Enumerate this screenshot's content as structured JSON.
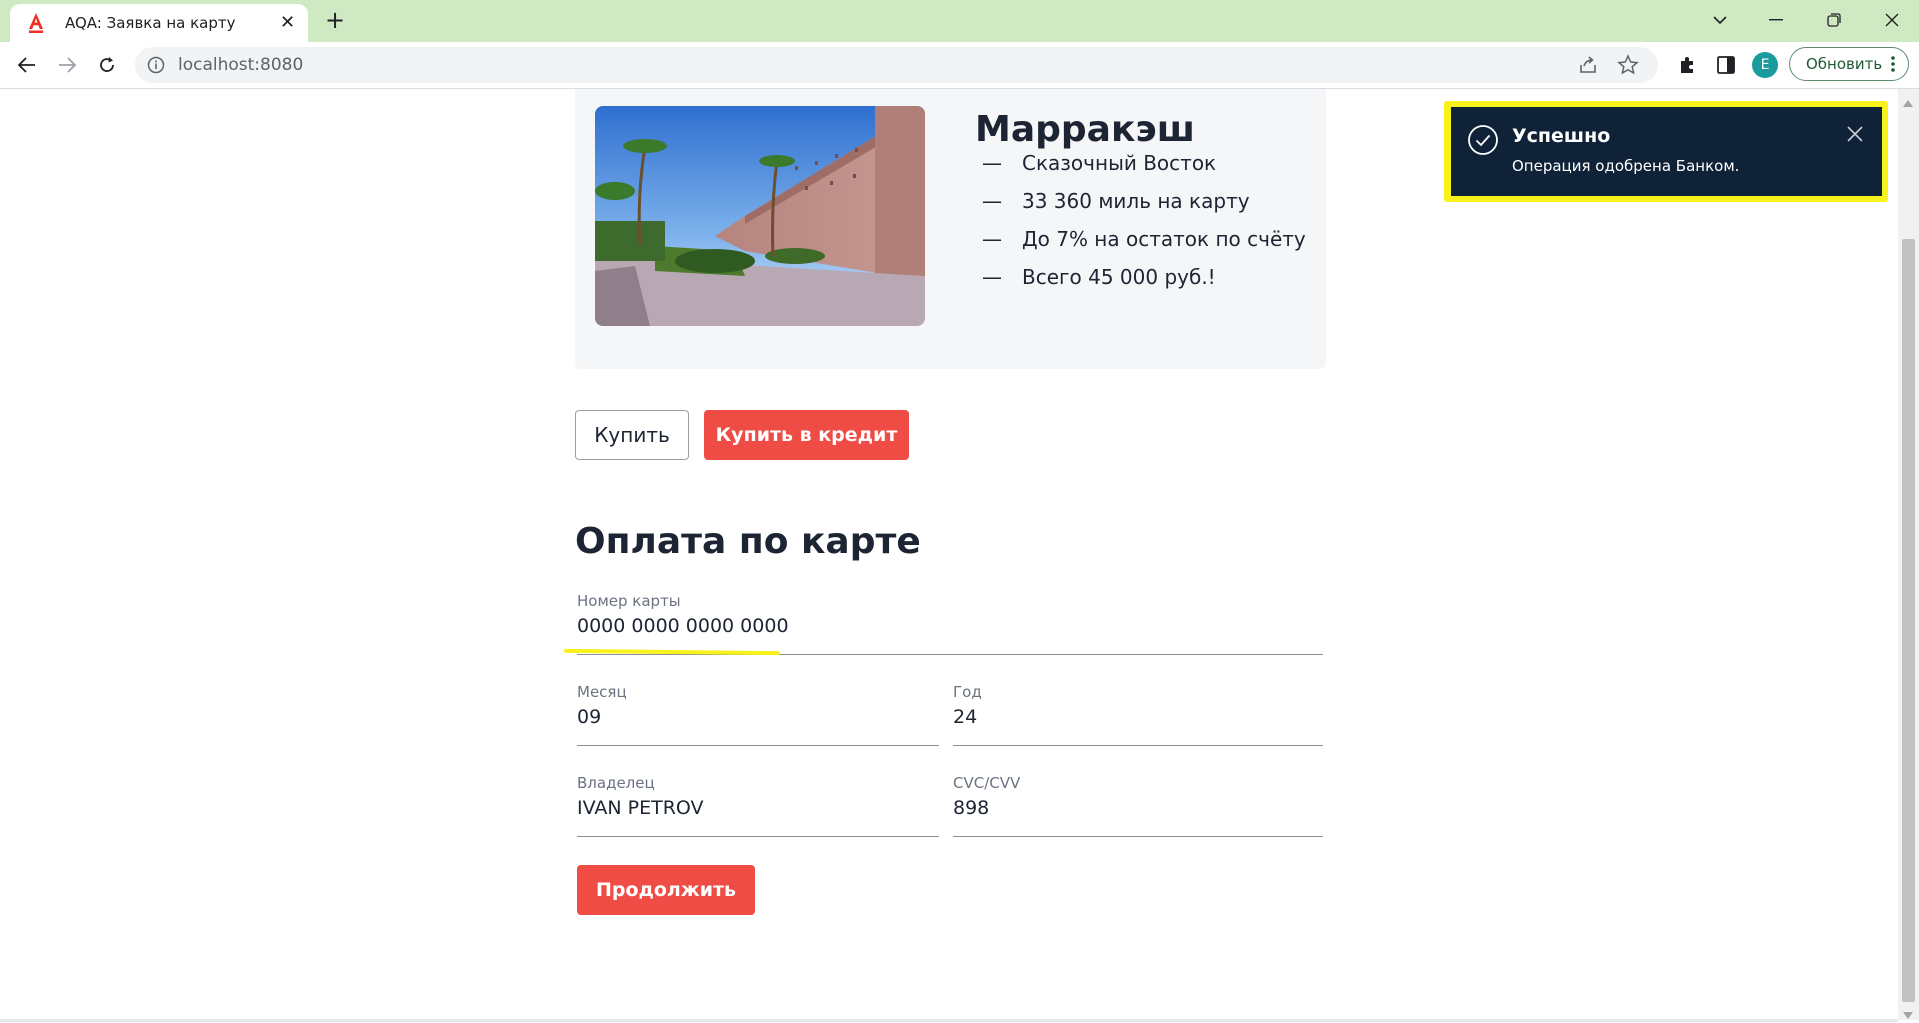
{
  "browser": {
    "tab_title": "AQA: Заявка на карту",
    "tab_close": "✕",
    "new_tab": "+",
    "url": "localhost:8080",
    "avatar_letter": "E",
    "update_label": "Обновить"
  },
  "offer": {
    "city": "Марракэш",
    "dash": "—",
    "features": [
      "Сказочный Восток",
      "33 360 миль на карту",
      "До 7% на остаток по счёту",
      "Всего 45 000 руб.!"
    ]
  },
  "actions": {
    "buy_label": "Купить",
    "credit_label": "Купить в кредит"
  },
  "payment": {
    "title": "Оплата по карте",
    "card_number": {
      "label": "Номер карты",
      "value": "0000 0000 0000 0000"
    },
    "month": {
      "label": "Месяц",
      "value": "09"
    },
    "year": {
      "label": "Год",
      "value": "24"
    },
    "owner": {
      "label": "Владелец",
      "value": "IVAN PETROV"
    },
    "cvc": {
      "label": "CVC/CVV",
      "value": "898"
    },
    "continue_label": "Продолжить"
  },
  "notification": {
    "title": "Успешно",
    "message": "Операция одобрена Банком."
  },
  "colors": {
    "tabbar": "#cfe9c3",
    "accent_red": "#ef4c45",
    "toast_bg": "#0f2238",
    "highlight": "#f7f21a",
    "text_dark": "#1d2433"
  },
  "icons": [
    "alfa-logo-icon",
    "close-icon",
    "plus-icon",
    "chevron-down-icon",
    "minimize-icon",
    "restore-icon",
    "back-arrow-icon",
    "forward-arrow-icon",
    "reload-icon",
    "info-icon",
    "share-icon",
    "star-icon",
    "puzzle-icon",
    "sidepanel-icon",
    "more-vert-icon",
    "check-circle-icon"
  ]
}
